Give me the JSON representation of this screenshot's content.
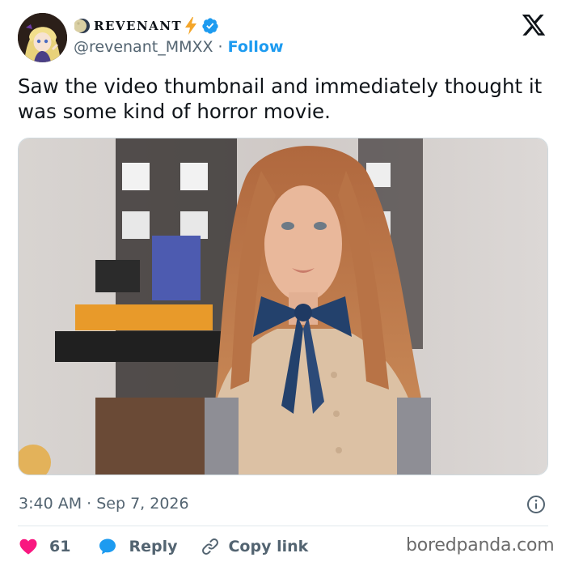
{
  "tweet": {
    "display_name": "REVENANT",
    "handle": "@revenant_MMXX",
    "separator": " · ",
    "follow_label": "Follow",
    "text": "Saw the video thumbnail and immediately thought it was some kind of horror movie.",
    "timestamp": "3:40 AM · Sep 7, 2026",
    "like_count": "61",
    "reply_label": "Reply",
    "copy_link_label": "Copy link"
  },
  "icons": {
    "avatar": "anime-character-avatar",
    "name_prefix": "moon-icon",
    "name_suffix": "lightning-bolt-icon",
    "verified": "verified-badge-icon",
    "platform": "x-logo-icon",
    "info": "info-icon",
    "like": "heart-icon",
    "reply": "speech-bubble-icon",
    "copy": "link-icon"
  },
  "colors": {
    "accent": "#1d9bf0",
    "like": "#f91880",
    "bolt": "#f4a62a",
    "muted_text": "#536471",
    "text": "#0f1419"
  },
  "watermark": "boredpanda.com"
}
